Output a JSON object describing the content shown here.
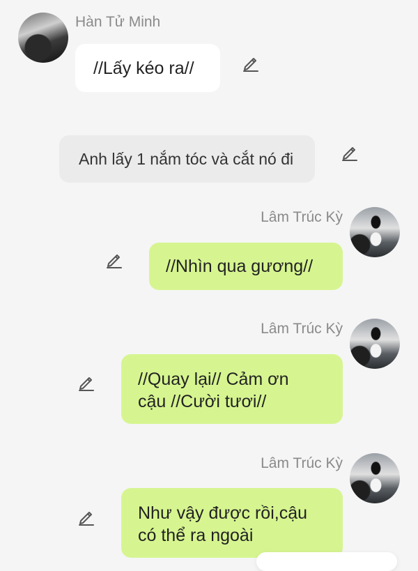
{
  "messages": [
    {
      "side": "left",
      "author": "Hàn Tử Minh",
      "text": "//Lấy kéo ra//"
    },
    {
      "side": "center",
      "text": "Anh lấy 1 nắm tóc và cắt nó đi"
    },
    {
      "side": "right",
      "author": "Lâm Trúc Kỳ",
      "text": "//Nhìn qua gương//"
    },
    {
      "side": "right",
      "author": "Lâm Trúc Kỳ",
      "text_lines": [
        "//Quay lại// Cảm ơn",
        "cậu //Cười tươi//"
      ]
    },
    {
      "side": "right",
      "author": "Lâm Trúc Kỳ",
      "text_lines": [
        "Như vậy được rồi,cậu",
        "có thể ra ngoài"
      ]
    }
  ],
  "icons": {
    "edit": "pencil-icon"
  },
  "colors": {
    "background": "#f5f5f5",
    "name_text": "#8a8a8a",
    "bubble_white": "#ffffff",
    "bubble_gray": "#ebebeb",
    "bubble_green": "#d6f590"
  },
  "popup": {
    "text": ""
  }
}
